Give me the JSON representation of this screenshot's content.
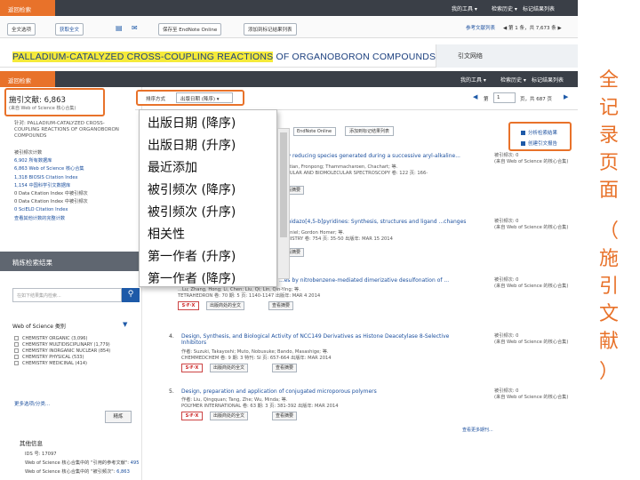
{
  "top_bar": {
    "back_label": "返回检索",
    "my_tools": "我的工具",
    "search_history": "检索历史",
    "marked_list": "标记结果列表"
  },
  "toolbar": {
    "full_text_options": "全文选项",
    "get_full_text": "获取全文",
    "save_to": "保存至 EndNote Online",
    "add_to_marked": "添加到标记结果列表",
    "ref_list": "参考文献列表",
    "pager": "◀ 第 1 条，共 7,673 条 ▶"
  },
  "article": {
    "title_highlight": "PALLADIUM-CATALYZED CROSS-COUPLING REACTIONS",
    "title_rest": " OF ORGANOBORON COMPOUNDS",
    "side_tab": "引文网络"
  },
  "results_bar": {
    "back_label": "返回检索",
    "my_tools": "我的工具",
    "search_history": "检索历史",
    "marked_list": "标记结果列表"
  },
  "left": {
    "count_label": "施引文献: 6,863",
    "count_sub": "(来自 Web of Science 核心合集)",
    "cited_for": "针对: PALLADIUM-CATALYZED CROSS-COUPLING REACTIONS OF ORGANOBORON COMPOUNDS",
    "db_items": [
      "被引频次计数",
      "6,902 所有数据库",
      "6,863 Web of Science 核心合集",
      "1,318 BIOSIS Citation Index",
      "1,154 中国科学引文数据库",
      "0 Data Citation Index 中被引频次",
      "0 Data Citation Index 中被引频次",
      "0 SciELO Citation Index",
      "查看其他计数的完整计数"
    ],
    "panel_title": "精炼检索结果",
    "search_placeholder": "在如下结果集内检索...",
    "wos_category_title": "Web of Science 类别",
    "categories": [
      "CHEMISTRY ORGANIC (3,096)",
      "CHEMISTRY MULTIDISCIPLINARY (1,779)",
      "CHEMISTRY INORGANIC NUCLEAR (854)",
      "CHEMISTRY PHYSICAL (533)",
      "CHEMISTRY MEDICINAL (414)"
    ],
    "more_options": "更多选项/分类...",
    "refine_button": "精炼",
    "other_info_title": "其他信息",
    "other_info_lines": [
      {
        "label": "IDS 号: 17097",
        "num": ""
      },
      {
        "label": "Web of Science 核心合集中的 \"引用的参考文献\": ",
        "num": "495"
      },
      {
        "label": "Web of Science 核心合集中的 \"被引频次\": ",
        "num": "6,863"
      }
    ]
  },
  "content_toolbar": {
    "sort_label": "排序方式",
    "sort_value": "出版日期 (降序)",
    "page_label": "第",
    "page_value": "1",
    "page_total": "页，共 687 页"
  },
  "sort_options": [
    "出版日期 (降序)",
    "出版日期 (升序)",
    "最近添加",
    "被引频次 (降序)",
    "被引频次 (升序)",
    "相关性",
    "第一作者 (升序)",
    "第一作者 (降序)"
  ],
  "actions": {
    "analyze": "分析检索结果",
    "citation_report": "创建引文报告"
  },
  "filter_row": {
    "save_value": "EndNote Online",
    "add_marked": "添加到标记结果列表"
  },
  "records": [
    {
      "num": "",
      "title": "...by reducing species generated during a successive aryl-alkaline...",
      "meta1": "...ngtian, Fronpong; Thammacharoen, Chachart; 等.",
      "meta2": "...ECULAR AND BIOMOLECULAR SPECTROSCOPY 卷: 122  页: 166-",
      "btn_view": "查看摘要",
      "times_cited": "被引频次: 0",
      "times_note": "(来自 Web of Science 的核心合集)"
    },
    {
      "num": "",
      "title": "...imidazo[4,5-b]pyridines: Synthesis, structures and ligand ...changes",
      "meta1": "...Daniel; Gordon Homer; 等.",
      "meta2": "...EMISTRY 卷: 754  页: 35-50  出版年: MAR 15 2014",
      "btn_view": "查看摘要",
      "times_cited": "被引频次: 0",
      "times_note": "(来自 Web of Science 的核心合集)"
    },
    {
      "num": "",
      "title": "...es by nitrobenzene-mediated dimerizative desulfonation of ...",
      "meta1": "...Lu; Zhang, Hong; Li, Chen; Liu, Qi; Lin, Qin-Ying; 等.",
      "meta2": "TETRAHEDRON 卷: 70  期: 5  页: 1140-1147  出版年: MAR 4 2014",
      "btn_full": "出版商处的全文",
      "btn_view": "查看摘要",
      "times_cited": "被引频次: 0",
      "times_note": "(来自 Web of Science 的核心合集)"
    },
    {
      "num": "4.",
      "title": "Design, Synthesis, and Biological Activity of NCC149 Derivatives as Histone Deacetylase 8-Selective Inhibitors",
      "meta1": "作者: Suzuki, Takayoshi; Muto, Nobusuke; Bando, Masashige; 等.",
      "meta2": "CHEMMEDCHEM 卷: 9  期: 3  特刊: SI  页: 657-664  出版年: MAR 2014",
      "btn_full": "出版商处的全文",
      "btn_view": "查看摘要",
      "times_cited": "被引频次: 0",
      "times_note": "(来自 Web of Science 的核心合集)"
    },
    {
      "num": "5.",
      "title": "Design, preparation and application of conjugated microporous polymers",
      "meta1": "作者: Liu, Qingquan; Tang, Zhe; Wu, Minda; 等.",
      "meta2": "POLYMER INTERNATIONAL 卷: 63  期: 3  页: 381-392  出版年: MAR 2014",
      "btn_full": "出版商处的全文",
      "btn_view": "查看摘要",
      "times_cited": "被引频次: 0",
      "times_note": "(来自 Web of Science 的核心合集)"
    }
  ],
  "sfx_label": "S·F·X",
  "bottom_link": "查看更多期刊...",
  "annotation": [
    "全",
    "记",
    "录",
    "页",
    "面",
    "（",
    "施",
    "引",
    "文",
    "献",
    "）"
  ]
}
